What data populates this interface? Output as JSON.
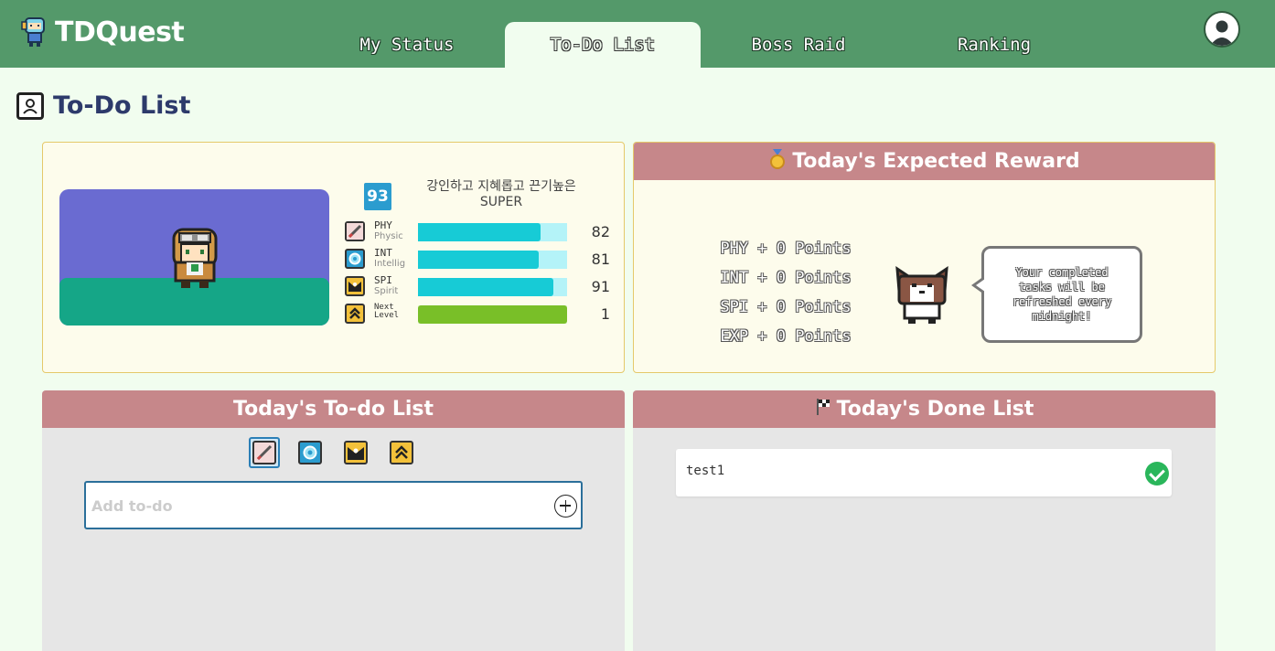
{
  "app": {
    "name": "TDQuest",
    "logo_icon": "pixel-knight-icon",
    "profile_icon": "user-avatar-icon"
  },
  "nav": {
    "tabs": [
      {
        "label": "My Status",
        "active": false
      },
      {
        "label": "To-Do List",
        "active": true
      },
      {
        "label": "Boss Raid",
        "active": false
      },
      {
        "label": "Ranking",
        "active": false
      }
    ]
  },
  "page": {
    "title": "To-Do List",
    "title_icon": "character-frame-icon"
  },
  "status": {
    "level": "93",
    "character_title": "강인하고 지혜롭고 끈기높은 SUPER",
    "stats": [
      {
        "abbr": "PHY",
        "name": "Physic",
        "value": "82",
        "fill_pct": 82,
        "icon": "sword-icon"
      },
      {
        "abbr": "INT",
        "name": "Intellig",
        "value": "81",
        "fill_pct": 81,
        "icon": "brain-gear-icon"
      },
      {
        "abbr": "SPI",
        "name": "Spirit",
        "value": "91",
        "fill_pct": 91,
        "icon": "spirit-icon"
      },
      {
        "abbr": "Next Level",
        "name": "",
        "value": "1",
        "fill_pct": 100,
        "icon": "level-up-chevron-icon"
      }
    ]
  },
  "reward": {
    "title": "Today's Expected Reward",
    "title_icon": "medal-icon",
    "lines": [
      "PHY + 0 Points",
      "INT + 0 Points",
      "SPI + 0 Points",
      "EXP + 0 Points"
    ],
    "speech": "Your completed tasks will be refreshed every midnight!"
  },
  "todo": {
    "title": "Today's To-do List",
    "categories": [
      {
        "icon": "sword-icon",
        "selected": true
      },
      {
        "icon": "brain-gear-icon",
        "selected": false
      },
      {
        "icon": "spirit-icon",
        "selected": false
      },
      {
        "icon": "level-up-chevron-icon",
        "selected": false
      }
    ],
    "input_placeholder": "Add to-do",
    "input_value": ""
  },
  "done": {
    "title": "Today's Done List",
    "title_icon": "checkered-flag-icon",
    "items": [
      {
        "text": "test1",
        "done": true
      }
    ]
  },
  "colors": {
    "topbar": "#54996a",
    "page_bg": "#f1fdef",
    "panel_head": "#c6878a",
    "stat_bar": "#17cbd6",
    "exp_bar": "#79bf28",
    "level_badge": "#2b9ccf",
    "check": "#2ab65b"
  }
}
